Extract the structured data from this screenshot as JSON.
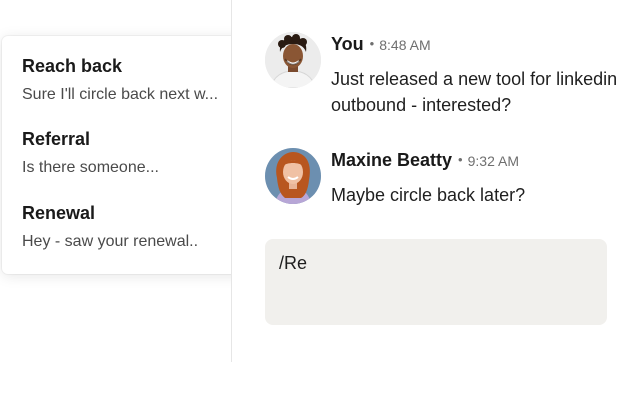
{
  "suggestions": [
    {
      "title": "Reach back",
      "preview": "Sure I'll circle back next w..."
    },
    {
      "title": "Referral",
      "preview": "Is there someone..."
    },
    {
      "title": "Renewal",
      "preview": "Hey - saw your renewal.."
    }
  ],
  "messages": [
    {
      "author": "You",
      "separator": "•",
      "time": "8:48 AM",
      "text": "Just released a new tool for linkedin outbound - interested?"
    },
    {
      "author": "Maxine Beatty",
      "separator": "•",
      "time": "9:32 AM",
      "text": "Maybe circle back later?"
    }
  ],
  "composer": {
    "value": "/Re"
  },
  "colors": {
    "composer_bg": "#f1f0ed",
    "text": "#1f1f1f",
    "muted": "#6f6f6f"
  }
}
